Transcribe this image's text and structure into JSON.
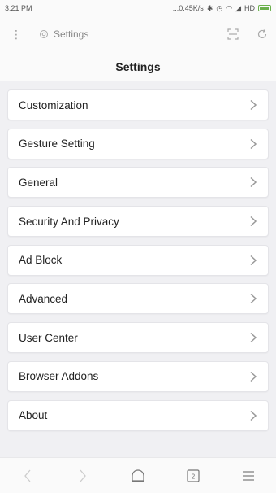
{
  "status_bar": {
    "time": "3:21 PM",
    "speed": "0.45K/s",
    "network": "HD"
  },
  "url_bar": {
    "text": "Settings"
  },
  "page": {
    "title": "Settings"
  },
  "settings_items": [
    {
      "label": "Customization"
    },
    {
      "label": "Gesture Setting"
    },
    {
      "label": "General"
    },
    {
      "label": "Security And Privacy"
    },
    {
      "label": "Ad Block"
    },
    {
      "label": "Advanced"
    },
    {
      "label": "User Center"
    },
    {
      "label": "Browser Addons"
    },
    {
      "label": "About"
    }
  ],
  "bottom_bar": {
    "tab_count": "2"
  }
}
